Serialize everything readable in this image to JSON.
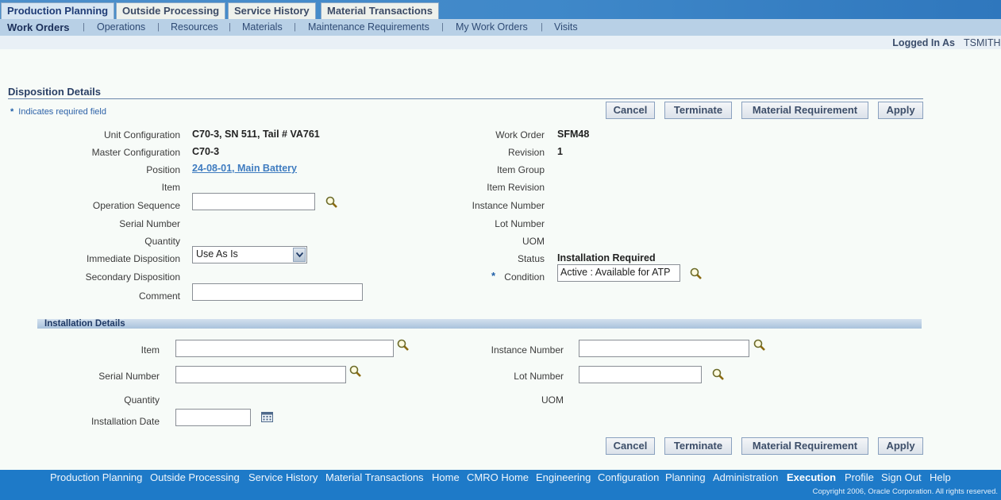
{
  "top_tabs": [
    "Production Planning",
    "Outside Processing",
    "Service History",
    "Material Transactions"
  ],
  "sub_nav": [
    "Work Orders",
    "Operations",
    "Resources",
    "Materials",
    "Maintenance Requirements",
    "My Work Orders",
    "Visits"
  ],
  "logged_in_label": "Logged In As",
  "logged_in_user": "TSMITH",
  "page_title": "Disposition Details",
  "required_note": "Indicates required field",
  "required_star": "*",
  "buttons": {
    "cancel": "Cancel",
    "terminate": "Terminate",
    "material_requirement": "Material Requirement",
    "apply": "Apply"
  },
  "disposition": {
    "unit_configuration": {
      "label": "Unit Configuration",
      "value": "C70-3, SN 511, Tail # VA761"
    },
    "master_configuration": {
      "label": "Master Configuration",
      "value": "C70-3"
    },
    "position": {
      "label": "Position",
      "value": "24-08-01, Main Battery"
    },
    "item": {
      "label": "Item"
    },
    "operation_sequence": {
      "label": "Operation Sequence",
      "value": ""
    },
    "serial_number": {
      "label": "Serial Number"
    },
    "quantity": {
      "label": "Quantity"
    },
    "immediate_disposition": {
      "label": "Immediate Disposition",
      "value": "Use As Is"
    },
    "secondary_disposition": {
      "label": "Secondary Disposition"
    },
    "comment": {
      "label": "Comment",
      "value": ""
    },
    "work_order": {
      "label": "Work Order",
      "value": "SFM48"
    },
    "revision": {
      "label": "Revision",
      "value": "1"
    },
    "item_group": {
      "label": "Item Group"
    },
    "item_revision": {
      "label": "Item Revision"
    },
    "instance_number": {
      "label": "Instance Number"
    },
    "lot_number": {
      "label": "Lot Number"
    },
    "uom": {
      "label": "UOM"
    },
    "status": {
      "label": "Status",
      "value": "Installation Required"
    },
    "condition": {
      "label": "Condition",
      "value": "Active : Available for ATP"
    }
  },
  "installation": {
    "title": "Installation Details",
    "item": {
      "label": "Item",
      "value": ""
    },
    "serial_number": {
      "label": "Serial Number",
      "value": ""
    },
    "quantity": {
      "label": "Quantity"
    },
    "installation_date": {
      "label": "Installation Date",
      "value": ""
    },
    "instance_number": {
      "label": "Instance Number",
      "value": ""
    },
    "lot_number": {
      "label": "Lot Number",
      "value": ""
    },
    "uom": {
      "label": "UOM"
    }
  },
  "footer_links": [
    "Production Planning",
    "Outside Processing",
    "Service History",
    "Material Transactions",
    "Home",
    "CMRO Home",
    "Engineering",
    "Configuration",
    "Planning",
    "Administration",
    "Execution",
    "Profile",
    "Sign Out",
    "Help"
  ],
  "copyright": "Copyright 2006, Oracle Corporation. All rights reserved.",
  "icons": {
    "search": "search-icon",
    "calendar": "calendar-icon",
    "dropdown": "chevron-down-icon"
  },
  "colors": {
    "accent": "#1e7ac8",
    "link": "#3f7cc0",
    "header_text": "#2a3f65"
  }
}
